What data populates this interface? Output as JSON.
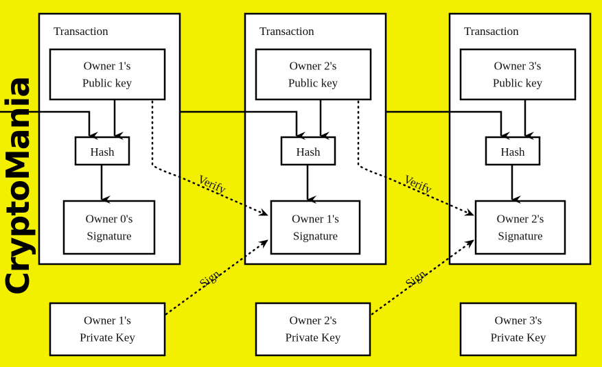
{
  "brand": {
    "name": "CryptoMania"
  },
  "colors": {
    "background": "#f3ef00",
    "box": "#ffffff",
    "stroke": "#000000"
  },
  "transactions": [
    {
      "title": "Transaction",
      "public_key": [
        "Owner 1's",
        "Public key"
      ],
      "hash": "Hash",
      "signature": [
        "Owner 0's",
        "Signature"
      ]
    },
    {
      "title": "Transaction",
      "public_key": [
        "Owner 2's",
        "Public key"
      ],
      "hash": "Hash",
      "signature": [
        "Owner 1's",
        "Signature"
      ]
    },
    {
      "title": "Transaction",
      "public_key": [
        "Owner 3's",
        "Public key"
      ],
      "hash": "Hash",
      "signature": [
        "Owner 2's",
        "Signature"
      ]
    }
  ],
  "private_keys": [
    [
      "Owner 1's",
      "Private Key"
    ],
    [
      "Owner 2's",
      "Private Key"
    ],
    [
      "Owner 3's",
      "Private Key"
    ]
  ],
  "annotations": {
    "verify": "Verify",
    "sign": "Sign"
  }
}
